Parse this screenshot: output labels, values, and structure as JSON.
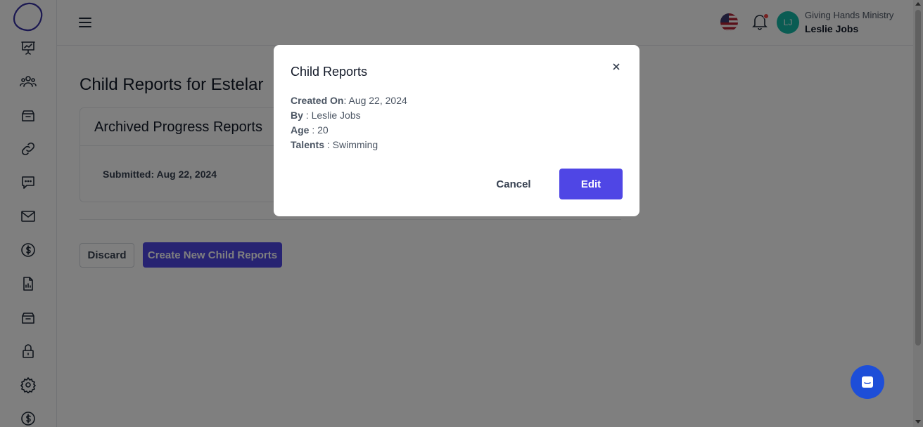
{
  "header": {
    "org_name": "Giving Hands Ministry",
    "user_name": "Leslie Jobs",
    "avatar_initials": "LJ",
    "flag": "us-flag-icon",
    "notification_dot": true
  },
  "sidebar": {
    "items": [
      {
        "icon": "presentation-chart-icon"
      },
      {
        "icon": "users-icon"
      },
      {
        "icon": "archive-box-icon"
      },
      {
        "icon": "link-icon"
      },
      {
        "icon": "chat-bubble-icon"
      },
      {
        "icon": "envelope-icon"
      },
      {
        "icon": "dollar-circle-icon"
      },
      {
        "icon": "document-chart-icon"
      },
      {
        "icon": "archive-box-icon"
      },
      {
        "icon": "lock-icon"
      },
      {
        "icon": "gear-icon"
      },
      {
        "icon": "dollar-circle-icon"
      }
    ]
  },
  "main": {
    "title": "Child Reports for Estelar",
    "card_title": "Archived Progress Reports",
    "submitted_label": "Submitted: Aug 22, 2024",
    "discard_label": "Discard",
    "create_label": "Create New Child Reports"
  },
  "modal": {
    "title": "Child Reports",
    "created_on_key": "Created On",
    "created_on_value": ": Aug 22, 2024",
    "by_key": "By",
    "by_value": " : Leslie Jobs",
    "age_key": "Age",
    "age_value": " : 20",
    "talents_key": "Talents",
    "talents_value": " : Swimming",
    "cancel_label": "Cancel",
    "edit_label": "Edit"
  },
  "colors": {
    "primary": "#4f46e5",
    "avatar_bg": "#14b8a6",
    "chat_bubble": "#1d4ed8",
    "logo": "#3730a3"
  }
}
